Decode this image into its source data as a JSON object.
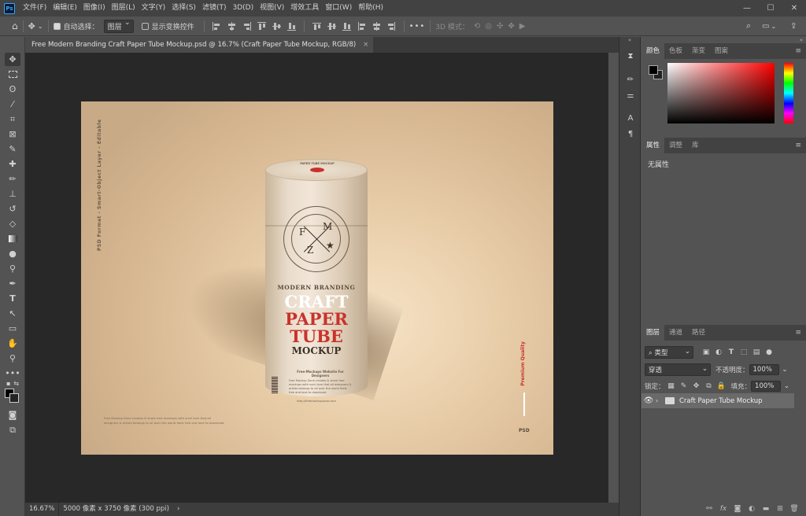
{
  "app": {
    "logo": "Ps"
  },
  "menu": [
    "文件(F)",
    "编辑(E)",
    "图像(I)",
    "图层(L)",
    "文字(Y)",
    "选择(S)",
    "滤镜(T)",
    "3D(D)",
    "视图(V)",
    "增效工具",
    "窗口(W)",
    "帮助(H)"
  ],
  "window_controls": {
    "minimize": "—",
    "maximize": "☐",
    "close": "✕"
  },
  "options": {
    "auto_select_label": "自动选择：",
    "auto_select_target": "图层",
    "show_transform_label": "显示变换控件",
    "mode_3d_label": "3D 模式：",
    "more": "•••"
  },
  "document": {
    "tab_title": "Free Modern Branding Craft Paper Tube Mockup.psd @ 16.7% (Craft Paper Tube Mockup, RGB/8)",
    "close": "×"
  },
  "artwork": {
    "side_text": "PSD Format  -  Smart-Object Layer  -  Editable",
    "footer_text": "Free Mockup Zone creates & share free mockups with such love that all designers & artists belongs to all over the world feels free and love to download.",
    "premium": "Premium Quality",
    "psd_label": "PSD",
    "tube_top_text": "PAPER TUBE MOCKUP",
    "seal_letters": {
      "f": "F",
      "m": "M",
      "z": "Z",
      "star": "★"
    },
    "line1": "MODERN BRANDING",
    "line2": "CRAFT",
    "line3": "PAPER",
    "line4": "TUBE",
    "line5": "MOCKUP",
    "small_title": "Free-Mockups Website For Designers",
    "small_body": "Free Mockup Zone creates & share free mockups with such love that all designers & artists belongs to all over the world feels free and love to download.",
    "url": "http://freemockupzone.com"
  },
  "status": {
    "zoom": "16.67%",
    "dims": "5000 像素 x 3750 像素 (300 ppi)",
    "arrow": "›"
  },
  "color_panel": {
    "tabs": [
      "颜色",
      "色板",
      "渐变",
      "图案"
    ],
    "active": 0
  },
  "props_panel": {
    "tabs": [
      "属性",
      "调整",
      "库"
    ],
    "active": 0,
    "empty_text": "无属性"
  },
  "layers_panel": {
    "tabs": [
      "图层",
      "通道",
      "路径"
    ],
    "active": 0,
    "filter_kind": "类型",
    "blend_mode": "穿透",
    "opacity_label": "不透明度：",
    "opacity": "100%",
    "lock_label": "锁定：",
    "fill_label": "填充：",
    "fill": "100%",
    "layers": [
      {
        "name": "Craft Paper Tube Mockup",
        "type": "group",
        "visible": true
      }
    ]
  }
}
